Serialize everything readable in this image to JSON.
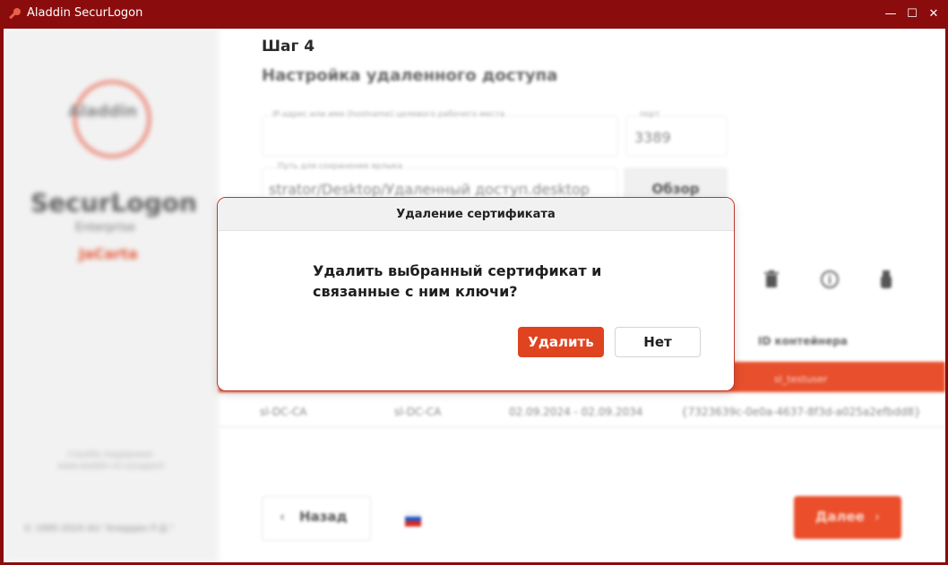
{
  "window": {
    "title": "Aladdin SecurLogon",
    "minimize": "—",
    "maximize": "☐",
    "close": "✕"
  },
  "sidebar": {
    "logo_text": "Aladdin",
    "brand": "SecurLogon",
    "brand_sub": "Enterprise",
    "brand_jc": "JaCarta",
    "note": "Служба поддержки: www.aladdin-rd.ru/support",
    "copyright": "© 1995-2024 АО \"Аладдин Р.Д.\""
  },
  "main": {
    "step": "Шаг 4",
    "step_title": "Настройка удаленного доступа",
    "host_label": "IP-адрес или имя (hostname) целевого рабочего места",
    "port_label": "порт",
    "port_value": "3389",
    "path_label": "Путь для сохранения ярлыка",
    "path_value": "strator/Desktop/Удаленный доступ.desktop",
    "browse_label": "Обзор",
    "table": {
      "header_container": "ID контейнера",
      "selected_row_container": "sl_testuser",
      "row": [
        "sl-DC-CA",
        "sl-DC-CA",
        "02.09.2024 - 02.09.2034",
        "{7323639c-0e0a-4637-8f3d-a025a2efbdd8}"
      ]
    },
    "back_label": "Назад",
    "next_label": "Далее"
  },
  "dialog": {
    "title": "Удаление сертификата",
    "message_line1": "Удалить выбранный сертификат и",
    "message_line2": "связанные с ним ключи?",
    "yes_label": "Удалить",
    "no_label": "Нет"
  },
  "colors": {
    "accent": "#e0431f",
    "titlebar": "#8b0c0c"
  }
}
